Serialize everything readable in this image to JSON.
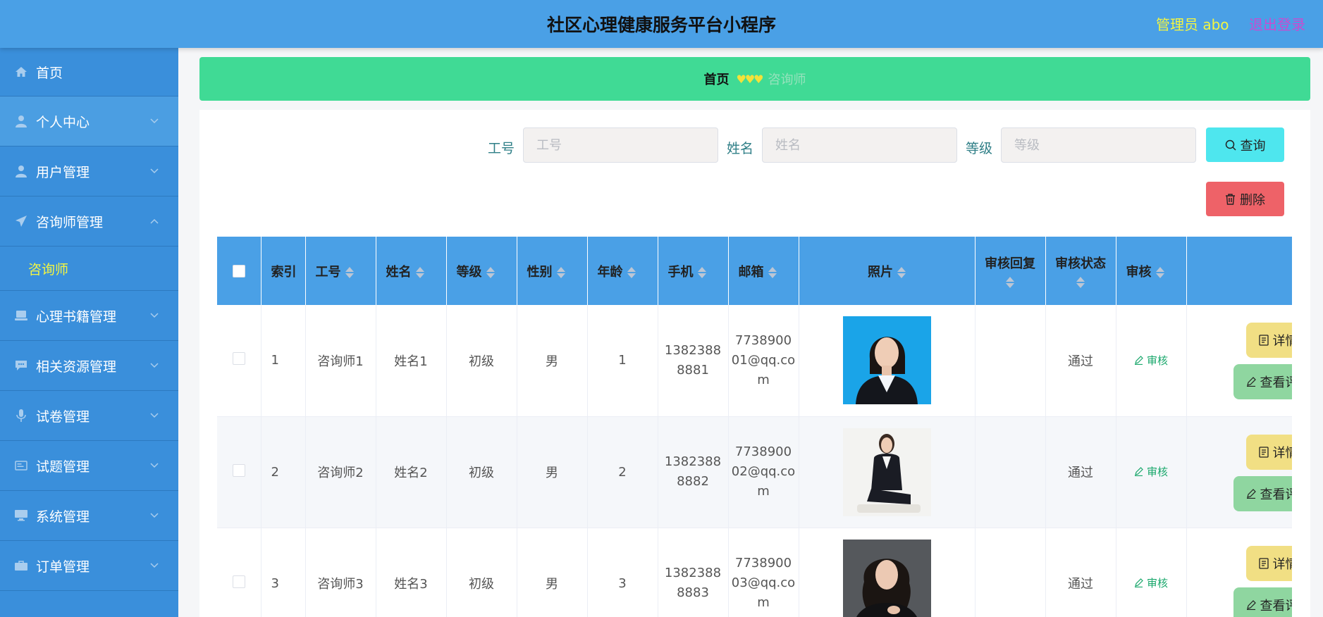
{
  "header": {
    "title": "社区心理健康服务平台小程序",
    "admin_label": "管理员 abo",
    "logout_label": "退出登录"
  },
  "sidebar": {
    "items": [
      {
        "label": "首页",
        "icon": "home-icon"
      },
      {
        "label": "个人中心",
        "icon": "user-icon"
      },
      {
        "label": "用户管理",
        "icon": "user-icon"
      },
      {
        "label": "咨询师管理",
        "icon": "paper-plane-icon"
      },
      {
        "label": "咨询师",
        "icon": ""
      },
      {
        "label": "心理书籍管理",
        "icon": "laptop-icon"
      },
      {
        "label": "相关资源管理",
        "icon": "chat-icon"
      },
      {
        "label": "试卷管理",
        "icon": "microphone-icon"
      },
      {
        "label": "试题管理",
        "icon": "card-icon"
      },
      {
        "label": "系统管理",
        "icon": "monitor-icon"
      },
      {
        "label": "订单管理",
        "icon": "briefcase-icon"
      }
    ]
  },
  "breadcrumb": {
    "home": "首页",
    "separator": "♥♥♥",
    "current": "咨询师"
  },
  "search": {
    "field1_label": "工号",
    "field1_placeholder": "工号",
    "field2_label": "姓名",
    "field2_placeholder": "姓名",
    "field3_label": "等级",
    "field3_placeholder": "等级",
    "query_label": "查询",
    "delete_label": "删除"
  },
  "table": {
    "headers": {
      "index": "索引",
      "job_no": "工号",
      "name": "姓名",
      "level": "等级",
      "gender": "性别",
      "age": "年龄",
      "phone": "手机",
      "email": "邮箱",
      "photo": "照片",
      "audit_reply": "审核回复",
      "audit_status": "审核状态",
      "audit": "审核"
    },
    "rows": [
      {
        "index": "1",
        "job_no": "咨询师1",
        "name": "姓名1",
        "level": "初级",
        "gender": "男",
        "age": "1",
        "phone": "13823888881",
        "email": "773890001@qq.com",
        "audit_reply": "",
        "audit_status": "通过",
        "audit_link": "审核",
        "detail_label": "详情",
        "view_label": "查看评价"
      },
      {
        "index": "2",
        "job_no": "咨询师2",
        "name": "姓名2",
        "level": "初级",
        "gender": "男",
        "age": "2",
        "phone": "13823888882",
        "email": "773890002@qq.com",
        "audit_reply": "",
        "audit_status": "通过",
        "audit_link": "审核",
        "detail_label": "详情",
        "view_label": "查看评价"
      },
      {
        "index": "3",
        "job_no": "咨询师3",
        "name": "姓名3",
        "level": "初级",
        "gender": "男",
        "age": "3",
        "phone": "13823888883",
        "email": "773890003@qq.com",
        "audit_reply": "",
        "audit_status": "通过",
        "audit_link": "审核",
        "detail_label": "详情",
        "view_label": "查看评价"
      }
    ]
  },
  "colors": {
    "header_bg": "#4aa0e6",
    "sidebar_bg": "#3a8fdb",
    "breadcrumb_bg": "#40da95",
    "accent_yellow": "#f3f542",
    "logout": "#c94bd0",
    "query_btn": "#4ee6ee",
    "delete_btn": "#ee6268"
  }
}
